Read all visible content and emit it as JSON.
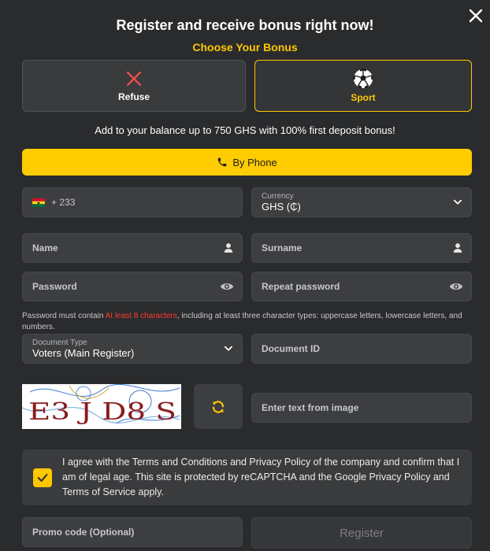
{
  "header": {
    "title": "Register and receive bonus right now!",
    "subtitle": "Choose Your Bonus"
  },
  "bonus_options": [
    {
      "label": "Refuse",
      "icon": "x-icon",
      "selected": false
    },
    {
      "label": "Sport",
      "icon": "soccer-ball-icon",
      "selected": true
    }
  ],
  "bonus_info": "Add to your balance up to 750 GHS with 100% first deposit bonus!",
  "tab": {
    "label": "By Phone"
  },
  "phone": {
    "prefix": "+ 233"
  },
  "currency": {
    "label": "Currency",
    "value": "GHS (₵)"
  },
  "fields": {
    "name": "Name",
    "surname": "Surname",
    "password": "Password",
    "repeat_password": "Repeat password",
    "document_id": "Document ID",
    "captcha_input": "Enter text from image",
    "promo_code": "Promo code (Optional)"
  },
  "password_hint": {
    "before": "Password must contain ",
    "highlight": "At least 8 characters",
    "after": ", including at least three character types: uppercase letters, lowercase letters, and numbers."
  },
  "document_type": {
    "label": "Document Type",
    "value": "Voters (Main Register)"
  },
  "captcha_text": "E3 J D8 S",
  "agreement": "I agree with the Terms and Conditions and Privacy Policy of the company and confirm that I am of legal age. This site is protected by reCAPTCHA and the Google Privacy Policy and Terms of Service apply.",
  "register_label": "Register",
  "colors": {
    "accent": "#ffc700",
    "background": "#2a2b2d",
    "field": "#3d3e40",
    "error": "#ff3b30"
  }
}
